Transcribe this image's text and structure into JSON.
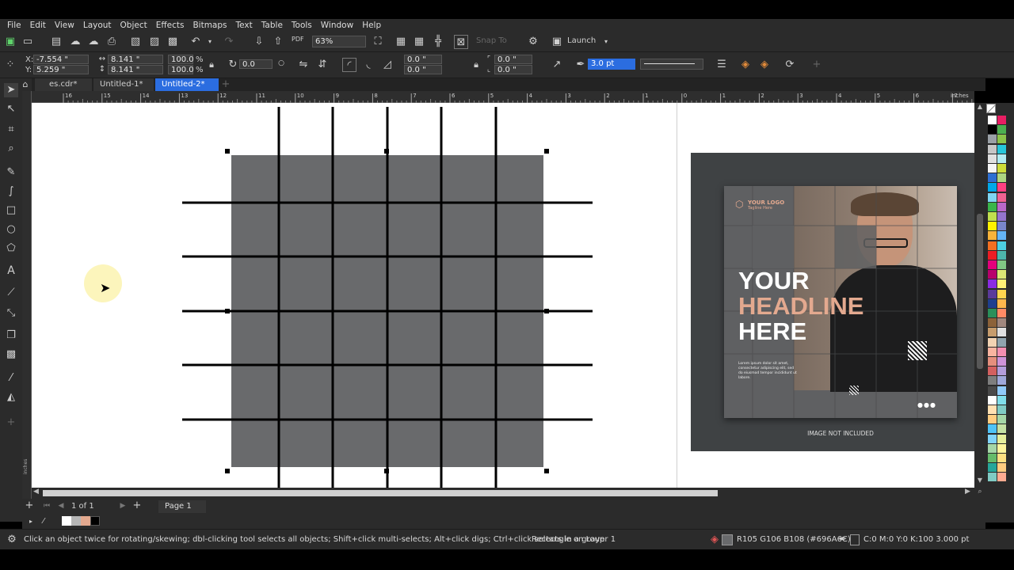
{
  "menu": [
    "File",
    "Edit",
    "View",
    "Layout",
    "Object",
    "Effects",
    "Bitmaps",
    "Text",
    "Table",
    "Tools",
    "Window",
    "Help"
  ],
  "toolbar": {
    "zoom": "63%",
    "snap_to": "Snap To",
    "launch": "Launch",
    "pdf_label": "PDF"
  },
  "propbar": {
    "x": "-7.554 \"",
    "y": "5.259 \"",
    "w": "8.141 \"",
    "h": "8.141 \"",
    "scale_w": "100.0",
    "scale_h": "100.0",
    "pct": "%",
    "angle": "0.0",
    "corner1": "0.0 \"",
    "corner2": "0.0 \"",
    "corner3": "0.0 \"",
    "corner4": "0.0 \"",
    "outline_width": "3.0 pt"
  },
  "tabs": [
    "es.cdr*",
    "Untitled-1*",
    "Untitled-2*"
  ],
  "ruler": {
    "h_ticks": [
      "16",
      "15",
      "14",
      "13",
      "12",
      "11",
      "10",
      "9",
      "8",
      "7",
      "6",
      "5",
      "4",
      "3",
      "2",
      "1",
      "0",
      "1",
      "2",
      "3",
      "4",
      "5",
      "6",
      "7"
    ],
    "unit": "inches",
    "v_unit": "inches"
  },
  "preview": {
    "logo": "YOUR LOGO",
    "tagline": "Tagline Here",
    "headline1": "YOUR",
    "headline2": "HEADLINE",
    "headline3": "HERE",
    "body": "Lorem ipsum dolor sit amet, consectetur adipiscing elit, sed do eiusmod tempor incididunt ut labore.",
    "not_included": "IMAGE NOT INCLUDED"
  },
  "pages": {
    "count": "1 of 1",
    "page": "Page 1"
  },
  "status": {
    "hint": "Click an object twice for rotating/skewing; dbl-clicking tool selects all objects; Shift+click multi-selects; Alt+click digs; Ctrl+click selects in a group",
    "selection": "Rectangle on Layer 1",
    "fill": "R105 G106 B108 (#696A6C)",
    "outline": "C:0 M:0 Y:0 K:100  3.000 pt"
  },
  "colors": {
    "accent": "#2b6de0",
    "rect_fill": "#696A6C",
    "headline_accent": "#e3a98f"
  }
}
